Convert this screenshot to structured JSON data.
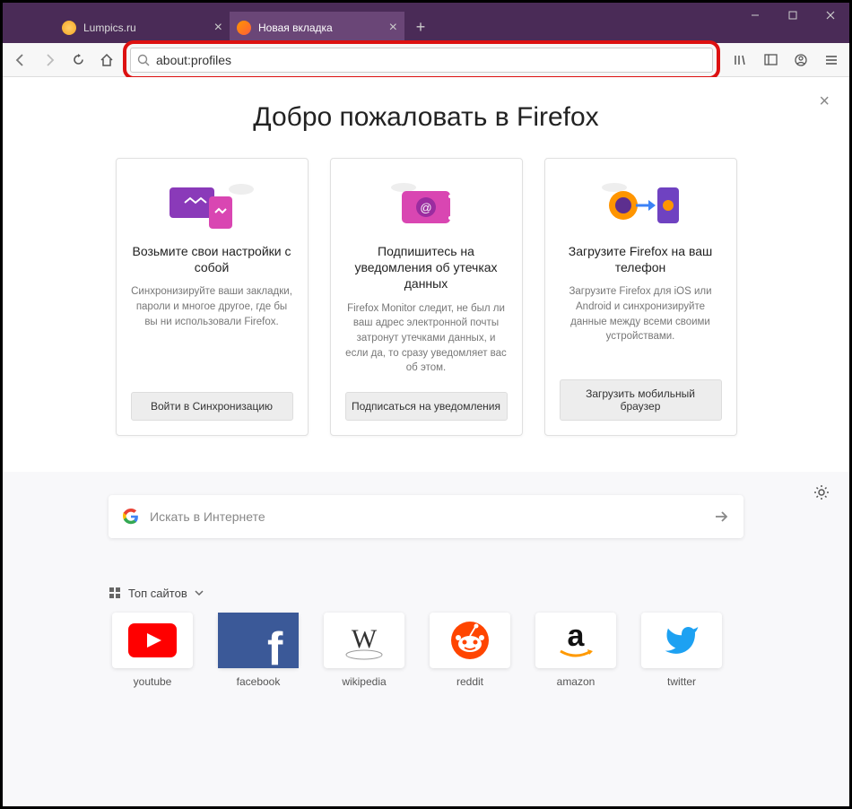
{
  "tabs": [
    {
      "title": "Lumpics.ru",
      "icon_color": "#f5a623",
      "active": false
    },
    {
      "title": "Новая вкладка",
      "icon_color": "#ff9500",
      "active": true
    }
  ],
  "urlbar": {
    "value": "about:profiles"
  },
  "welcome": {
    "title": "Добро пожаловать в Firefox",
    "cards": [
      {
        "title": "Возьмите свои настройки с собой",
        "desc": "Синхронизируйте ваши закладки, пароли и многое другое, где бы вы ни использовали Firefox.",
        "button": "Войти в Синхронизацию"
      },
      {
        "title": "Подпишитесь на уведомления об утечках данных",
        "desc": "Firefox Monitor следит, не был ли ваш адрес электронной почты затронут утечками данных, и если да, то сразу уведомляет вас об этом.",
        "button": "Подписаться на уведомления"
      },
      {
        "title": "Загрузите Firefox на ваш телефон",
        "desc": "Загрузите Firefox для iOS или Android и синхронизируйте данные между всеми своими устройствами.",
        "button": "Загрузить мобильный браузер"
      }
    ]
  },
  "search": {
    "placeholder": "Искать в Интернете"
  },
  "topsites": {
    "header": "Топ сайтов",
    "sites": [
      {
        "label": "youtube"
      },
      {
        "label": "facebook"
      },
      {
        "label": "wikipedia"
      },
      {
        "label": "reddit"
      },
      {
        "label": "amazon"
      },
      {
        "label": "twitter"
      }
    ]
  }
}
